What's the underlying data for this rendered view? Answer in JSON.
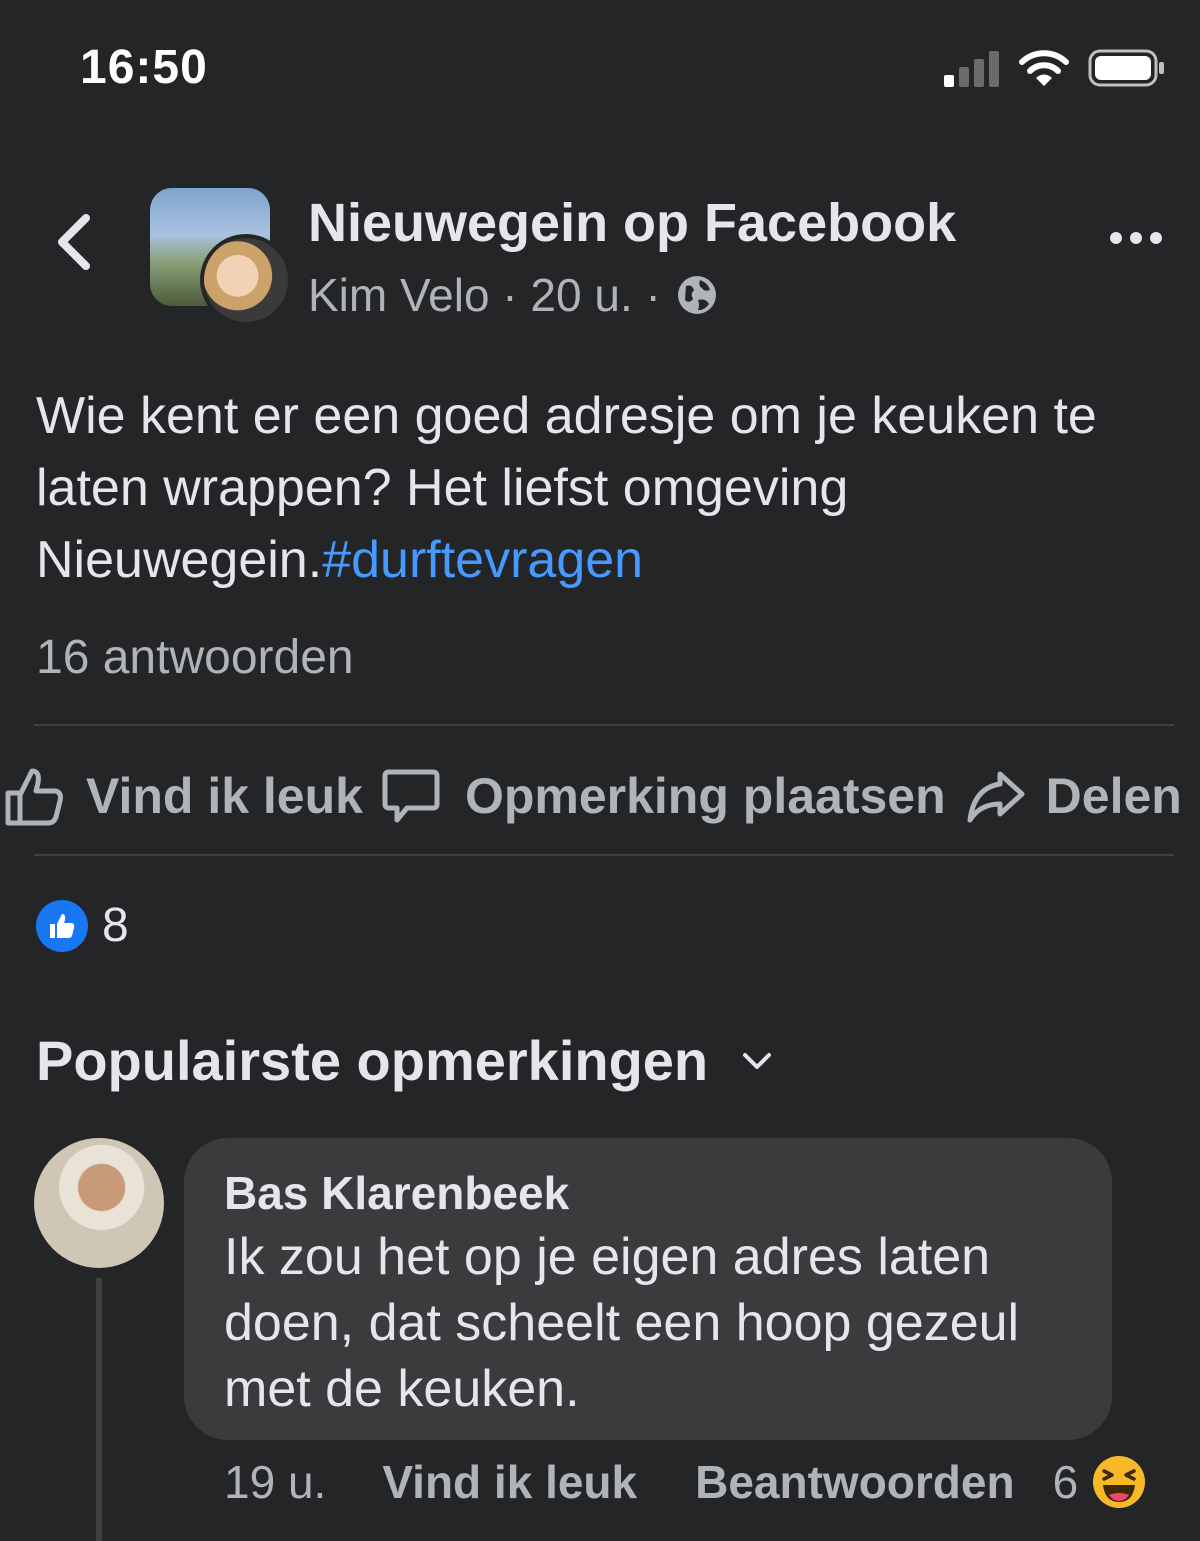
{
  "status_bar": {
    "time": "16:50"
  },
  "header": {
    "group_name": "Nieuwegein op Facebook",
    "author": "Kim Velo",
    "separator": " · ",
    "time_ago": "20 u."
  },
  "post": {
    "text": "Wie kent er een goed adresje om je keuken te laten wrappen? Het liefst omgeving Nieuwegein.",
    "hashtag": "#durftevragen",
    "replies_label": "16 antwoorden"
  },
  "actions": {
    "like": "Vind ik leuk",
    "comment": "Opmerking plaatsen",
    "share": "Delen"
  },
  "reactions": {
    "count": "8"
  },
  "comments_section": {
    "sort_label": "Populairste opmerkingen"
  },
  "comment": {
    "author": "Bas Klarenbeek",
    "text": "Ik zou het op je eigen adres laten doen, dat scheelt een hoop gezeul met de keuken.",
    "time_ago": "19 u.",
    "like_label": "Vind ik leuk",
    "reply_label": "Beantwoorden",
    "reaction_count": "6"
  },
  "colors": {
    "background": "#242526",
    "bubble": "#3a3b3c",
    "link": "#4599ff",
    "like_blue": "#1877f2",
    "laugh_yellow": "#f7b928"
  },
  "icons": [
    "signal-icon",
    "wifi-icon",
    "battery-icon",
    "back-arrow-icon",
    "more-icon",
    "globe-icon",
    "like-icon",
    "comment-icon",
    "share-icon",
    "like-reaction-icon",
    "chevron-down-icon",
    "laugh-reaction-icon"
  ]
}
